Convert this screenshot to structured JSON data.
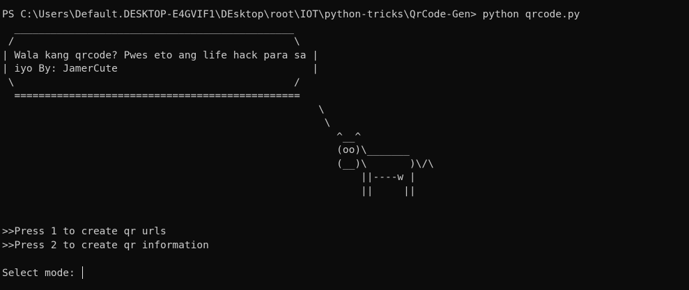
{
  "terminal": {
    "prompt": "PS C:\\Users\\Default.DESKTOP-E4GVIF1\\DEsktop\\root\\IOT\\python-tricks\\QrCode-Gen> python qrcode.py",
    "banner": [
      "  ______________________________________________",
      " /                                              \\",
      "| Wala kang qrcode? Pwes eto ang life hack para sa |",
      "| iyo By: JamerCute                                |",
      " \\                                              /",
      "  ==============================================="
    ],
    "cow": [
      "                                                    \\",
      "                                                     \\",
      "                                                       ^__^",
      "                                                       (oo)\\_______",
      "                                                       (__)\\       )\\/\\",
      "                                                           ||----w |",
      "                                                           ||     ||"
    ],
    "menu": [
      ">>Press 1 to create qr urls",
      ">>Press 2 to create qr information"
    ],
    "input_prompt": "Select mode: ",
    "input_value": ""
  }
}
